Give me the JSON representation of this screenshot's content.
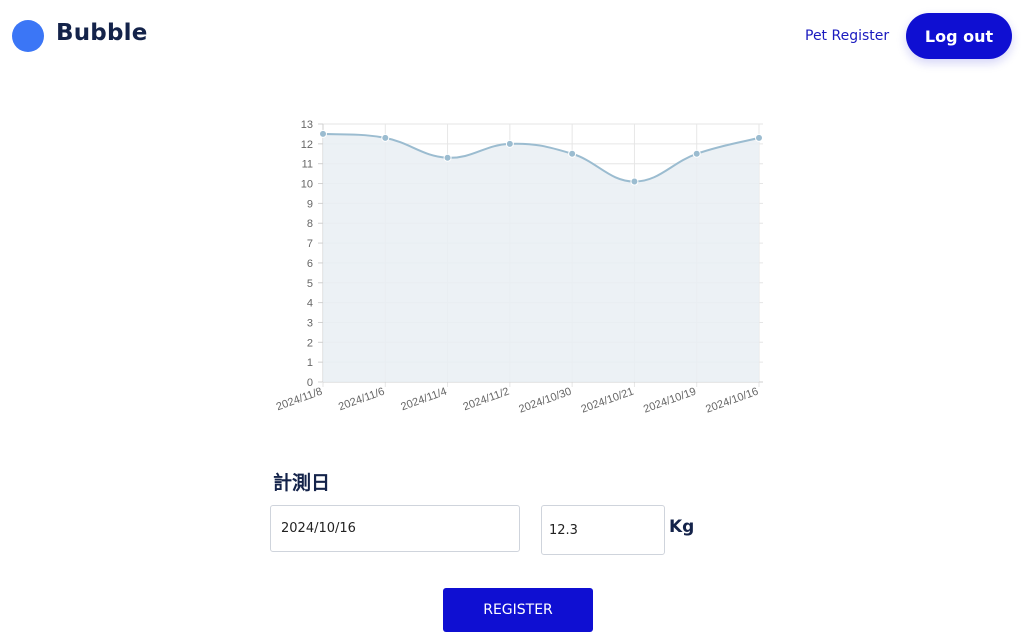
{
  "header": {
    "brand": "Bubble",
    "nav_pet_register": "Pet Register",
    "logout_label": "Log out"
  },
  "colors": {
    "accent": "#0f0fd2",
    "logo": "#3b76f6",
    "line": "#9bbcd0",
    "fill": "#e9eff3"
  },
  "chart_data": {
    "type": "line",
    "x": [
      "2024/11/8",
      "2024/11/6",
      "2024/11/4",
      "2024/11/2",
      "2024/10/30",
      "2024/10/21",
      "2024/10/19",
      "2024/10/16"
    ],
    "values": [
      12.5,
      12.3,
      11.3,
      12.0,
      11.5,
      10.1,
      11.5,
      12.3
    ],
    "ylim": [
      0,
      13
    ],
    "yticks": [
      "0",
      "1",
      "2",
      "3",
      "4",
      "5",
      "6",
      "7",
      "8",
      "9",
      "10",
      "11",
      "12",
      "13"
    ],
    "grid": true,
    "filled": true,
    "smooth": true
  },
  "form": {
    "date_label": "計測日",
    "date_value": "2024/10/16",
    "weight_value": "12.3",
    "unit": "Kg",
    "register_label": "REGISTER"
  }
}
